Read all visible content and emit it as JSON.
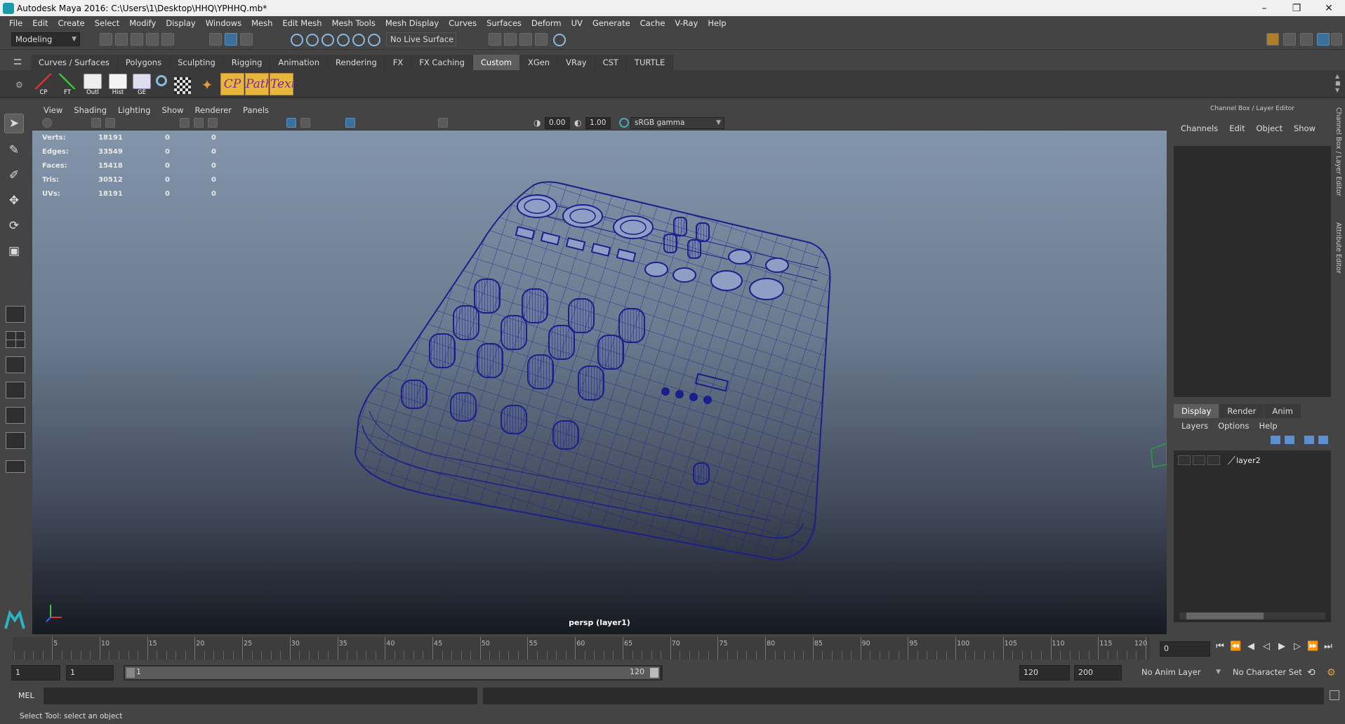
{
  "window": {
    "title": "Autodesk Maya 2016: C:\\Users\\1\\Desktop\\HHQ\\YPHHQ.mb*",
    "minimize": "–",
    "maximize": "❐",
    "close": "✕"
  },
  "menubar": [
    "File",
    "Edit",
    "Create",
    "Select",
    "Modify",
    "Display",
    "Windows",
    "Mesh",
    "Edit Mesh",
    "Mesh Tools",
    "Mesh Display",
    "Curves",
    "Surfaces",
    "Deform",
    "UV",
    "Generate",
    "Cache",
    "V-Ray",
    "Help"
  ],
  "statusline": {
    "mode": "Modeling",
    "live_surface": "No Live Surface"
  },
  "shelf": {
    "tabs": [
      "Curves / Surfaces",
      "Polygons",
      "Sculpting",
      "Rigging",
      "Animation",
      "Rendering",
      "FX",
      "FX Caching",
      "Custom",
      "XGen",
      "VRay",
      "CST",
      "TURTLE"
    ],
    "active_tab": "Custom",
    "buttons": [
      {
        "label": "CP",
        "icon": "axis-icon"
      },
      {
        "label": "FT",
        "icon": "axis-icon"
      },
      {
        "label": "Outl",
        "icon": "outliner-icon"
      },
      {
        "label": "Hist",
        "icon": "history-icon"
      },
      {
        "label": "GE",
        "icon": "graph-editor-icon"
      }
    ],
    "text_buttons": [
      "CP",
      "Path",
      "Text"
    ]
  },
  "viewport": {
    "menu": [
      "View",
      "Shading",
      "Lighting",
      "Show",
      "Renderer",
      "Panels"
    ],
    "exposure": "0.00",
    "gamma": "1.00",
    "color_space": "sRGB gamma",
    "hud": [
      {
        "label": "Verts:",
        "v1": "18191",
        "v2": "0",
        "v3": "0"
      },
      {
        "label": "Edges:",
        "v1": "33549",
        "v2": "0",
        "v3": "0"
      },
      {
        "label": "Faces:",
        "v1": "15418",
        "v2": "0",
        "v3": "0"
      },
      {
        "label": "Tris:",
        "v1": "30512",
        "v2": "0",
        "v3": "0"
      },
      {
        "label": "UVs:",
        "v1": "18191",
        "v2": "0",
        "v3": "0"
      }
    ],
    "camera_label": "persp (layer1)",
    "wire_color": "#1a1f8a"
  },
  "channel_box": {
    "header": "Channel Box / Layer Editor",
    "menu": [
      "Channels",
      "Edit",
      "Object",
      "Show"
    ],
    "layer_tabs": [
      "Display",
      "Render",
      "Anim"
    ],
    "active_layer_tab": "Display",
    "layer_menu": [
      "Layers",
      "Options",
      "Help"
    ],
    "layers": [
      {
        "name": "layer2"
      }
    ],
    "side_tabs": [
      "Channel Box / Layer Editor",
      "Attribute Editor"
    ]
  },
  "time_slider": {
    "ticks": [
      "5",
      "10",
      "15",
      "20",
      "25",
      "30",
      "35",
      "40",
      "45",
      "50",
      "55",
      "60",
      "65",
      "70",
      "75",
      "80",
      "85",
      "90",
      "95",
      "100",
      "105",
      "110",
      "115",
      "120"
    ],
    "current_frame": "0"
  },
  "range": {
    "start": "1",
    "start2": "1",
    "range_start": "1",
    "range_end": "120",
    "end": "120",
    "end2": "200",
    "anim_layer": "No Anim Layer",
    "char_set": "No Character Set"
  },
  "command": {
    "lang": "MEL",
    "help": "Select Tool: select an object"
  }
}
